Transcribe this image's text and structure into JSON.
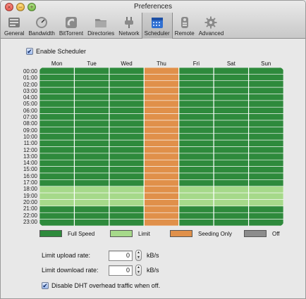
{
  "window": {
    "title": "Preferences"
  },
  "traffic_lights": {
    "close": "×",
    "minimize": "−",
    "zoom": "+"
  },
  "toolbar": {
    "items": [
      {
        "label": "General",
        "icon": "general-icon"
      },
      {
        "label": "Bandwidth",
        "icon": "gauge-icon"
      },
      {
        "label": "BitTorrent",
        "icon": "bittorrent-icon"
      },
      {
        "label": "Directories",
        "icon": "folder-icon"
      },
      {
        "label": "Network",
        "icon": "plug-icon"
      },
      {
        "label": "Scheduler",
        "icon": "calendar-icon",
        "active": true
      },
      {
        "label": "Remote",
        "icon": "remote-icon"
      },
      {
        "label": "Advanced",
        "icon": "gear-icon"
      }
    ]
  },
  "scheduler": {
    "enable_label": "Enable Scheduler",
    "enabled": true,
    "days": [
      "Mon",
      "Tue",
      "Wed",
      "Thu",
      "Fri",
      "Sat",
      "Sun"
    ],
    "hours": [
      "00:00",
      "01:00",
      "02:00",
      "03:00",
      "04:00",
      "05:00",
      "06:00",
      "07:00",
      "08:00",
      "09:00",
      "10:00",
      "11:00",
      "12:00",
      "13:00",
      "14:00",
      "15:00",
      "16:00",
      "17:00",
      "18:00",
      "19:00",
      "20:00",
      "21:00",
      "22:00",
      "23:00"
    ],
    "modes": {
      "full": {
        "label": "Full Speed",
        "color": "#2e8a3c"
      },
      "limit": {
        "label": "Limit",
        "color": "#a6d98a"
      },
      "seed": {
        "label": "Seeding Only",
        "color": "#e0904a"
      },
      "off": {
        "label": "Off",
        "color": "#8c8c8c"
      }
    },
    "schedule": {
      "Mon": [
        "full",
        "full",
        "full",
        "full",
        "full",
        "full",
        "full",
        "full",
        "full",
        "full",
        "full",
        "full",
        "full",
        "full",
        "full",
        "full",
        "full",
        "full",
        "limit",
        "limit",
        "limit",
        "full",
        "full",
        "full"
      ],
      "Tue": [
        "full",
        "full",
        "full",
        "full",
        "full",
        "full",
        "full",
        "full",
        "full",
        "full",
        "full",
        "full",
        "full",
        "full",
        "full",
        "full",
        "full",
        "full",
        "limit",
        "limit",
        "limit",
        "full",
        "full",
        "full"
      ],
      "Wed": [
        "full",
        "full",
        "full",
        "full",
        "full",
        "full",
        "full",
        "full",
        "full",
        "full",
        "full",
        "full",
        "full",
        "full",
        "full",
        "full",
        "full",
        "full",
        "limit",
        "limit",
        "limit",
        "full",
        "full",
        "full"
      ],
      "Thu": [
        "seed",
        "seed",
        "seed",
        "seed",
        "seed",
        "seed",
        "seed",
        "seed",
        "seed",
        "seed",
        "seed",
        "seed",
        "seed",
        "seed",
        "seed",
        "seed",
        "seed",
        "seed",
        "seed",
        "seed",
        "seed",
        "seed",
        "seed",
        "seed"
      ],
      "Fri": [
        "full",
        "full",
        "full",
        "full",
        "full",
        "full",
        "full",
        "full",
        "full",
        "full",
        "full",
        "full",
        "full",
        "full",
        "full",
        "full",
        "full",
        "full",
        "limit",
        "limit",
        "limit",
        "full",
        "full",
        "full"
      ],
      "Sat": [
        "full",
        "full",
        "full",
        "full",
        "full",
        "full",
        "full",
        "full",
        "full",
        "full",
        "full",
        "full",
        "full",
        "full",
        "full",
        "full",
        "full",
        "full",
        "limit",
        "limit",
        "limit",
        "full",
        "full",
        "full"
      ],
      "Sun": [
        "full",
        "full",
        "full",
        "full",
        "full",
        "full",
        "full",
        "full",
        "full",
        "full",
        "full",
        "full",
        "full",
        "full",
        "full",
        "full",
        "full",
        "full",
        "limit",
        "limit",
        "limit",
        "full",
        "full",
        "full"
      ]
    },
    "legend": [
      "full",
      "limit",
      "seed",
      "off"
    ]
  },
  "limits": {
    "upload_label": "Limit upload rate:",
    "upload_value": "0",
    "upload_unit": "kB/s",
    "download_label": "Limit download rate:",
    "download_value": "0",
    "download_unit": "kB/s",
    "stepper_up": "▲",
    "stepper_down": "▼"
  },
  "dht": {
    "label": "Disable DHT overhead traffic when off.",
    "checked": true,
    "check_glyph": "✔"
  }
}
